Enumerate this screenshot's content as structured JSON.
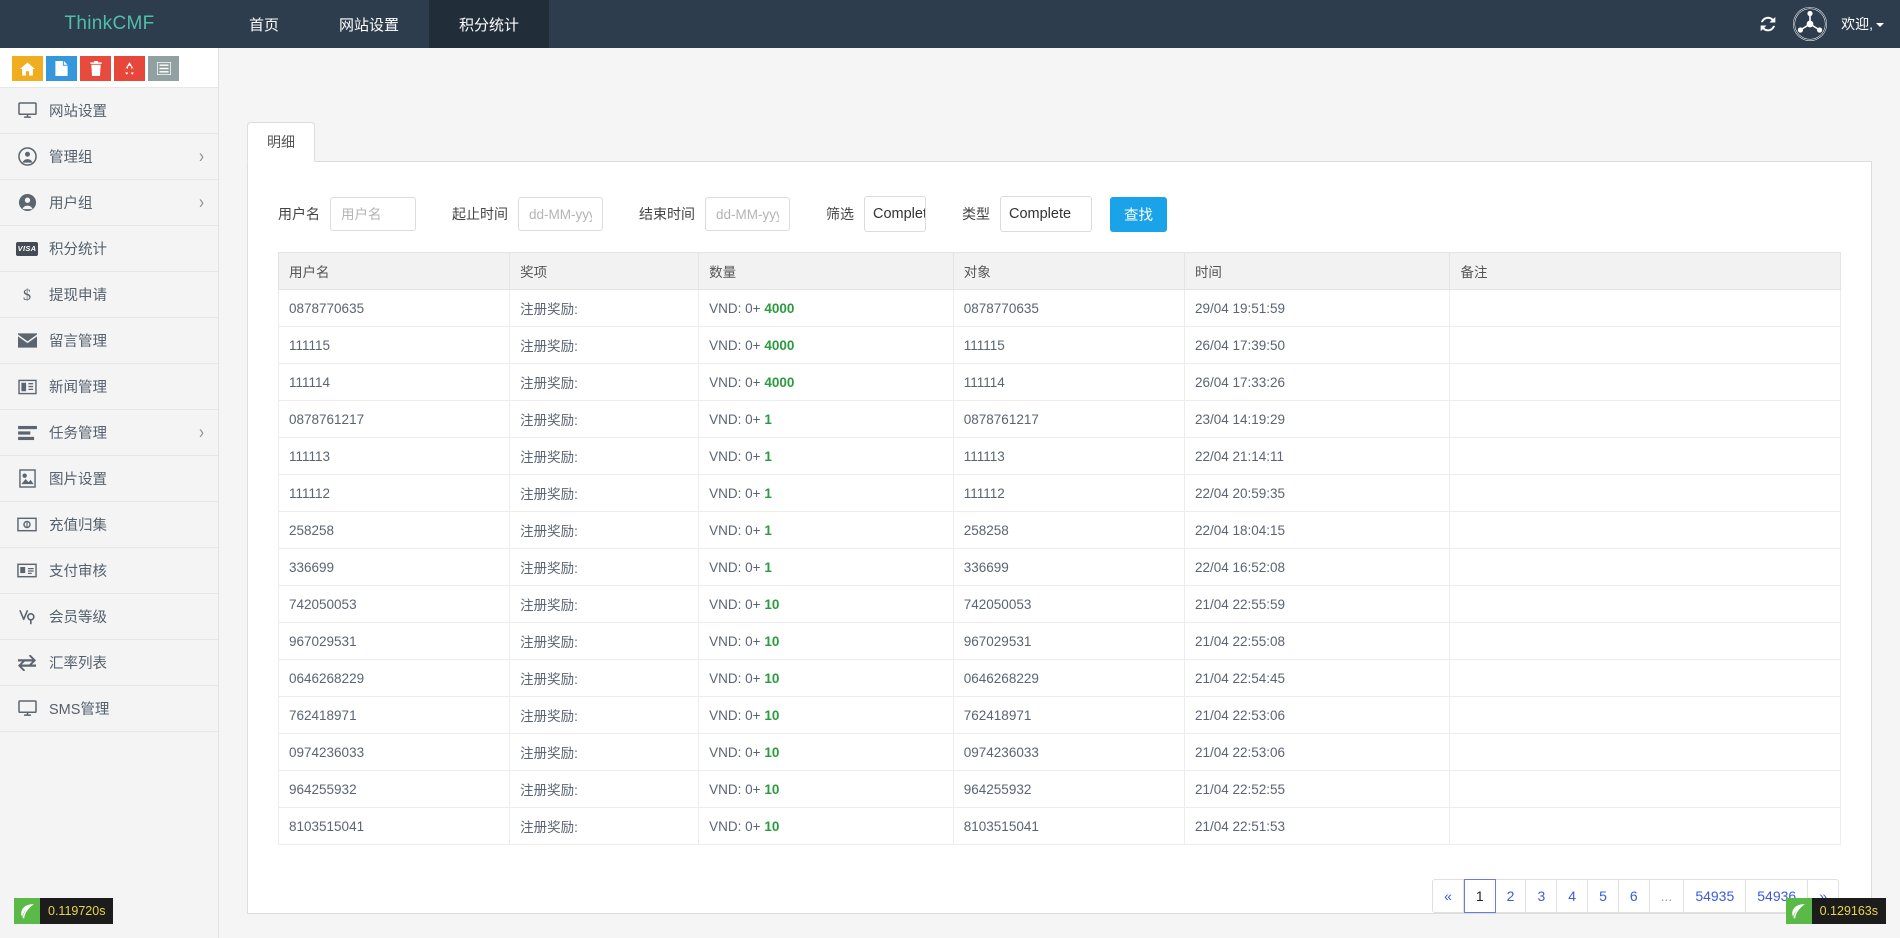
{
  "topnav": {
    "brand": "ThinkCMF",
    "items": [
      {
        "label": "首页",
        "active": false
      },
      {
        "label": "网站设置",
        "active": false
      },
      {
        "label": "积分统计",
        "active": true
      }
    ],
    "refresh_icon": "refresh-icon",
    "avatar_icon": "user-avatar-icon",
    "welcome": "欢迎,"
  },
  "sidebar": {
    "quick_buttons": [
      {
        "name": "home-quick-button",
        "icon": "home-icon",
        "color": "#f0ad20"
      },
      {
        "name": "new-page-quick-button",
        "icon": "file-icon",
        "color": "#3598dc"
      },
      {
        "name": "trash-quick-button",
        "icon": "trash-icon",
        "color": "#e74b3e"
      },
      {
        "name": "recycle-quick-button",
        "icon": "recycle-icon",
        "color": "#e7463a"
      },
      {
        "name": "list-quick-button",
        "icon": "list-icon",
        "color": "#91a0a0"
      }
    ],
    "items": [
      {
        "label": "网站设置",
        "icon": "monitor-icon",
        "arrow": false
      },
      {
        "label": "管理组",
        "icon": "user-circle-icon",
        "arrow": true
      },
      {
        "label": "用户组",
        "icon": "user-filled-icon",
        "arrow": true
      },
      {
        "label": "积分统计",
        "icon": "visa-card-icon",
        "arrow": false
      },
      {
        "label": "提现申请",
        "icon": "dollar-icon",
        "arrow": false
      },
      {
        "label": "留言管理",
        "icon": "envelope-icon",
        "arrow": false
      },
      {
        "label": "新闻管理",
        "icon": "newspaper-icon",
        "arrow": false
      },
      {
        "label": "任务管理",
        "icon": "tasks-icon",
        "arrow": true
      },
      {
        "label": "图片设置",
        "icon": "image-icon",
        "arrow": false
      },
      {
        "label": "充值归集",
        "icon": "money-bill-icon",
        "arrow": false
      },
      {
        "label": "支付审核",
        "icon": "id-card-icon",
        "arrow": false
      },
      {
        "label": "会员等级",
        "icon": "vip-icon",
        "arrow": false
      },
      {
        "label": "汇率列表",
        "icon": "exchange-arrows-icon",
        "arrow": false
      },
      {
        "label": "SMS管理",
        "icon": "monitor-icon",
        "arrow": false
      }
    ]
  },
  "main": {
    "tabs": [
      {
        "label": "明细",
        "active": true
      }
    ],
    "filter": {
      "username_label": "用户名",
      "username_placeholder": "用户名",
      "username_value": "",
      "start_label": "起止时间",
      "start_placeholder": "dd-MM-yyyy",
      "start_value": "",
      "end_label": "结束时间",
      "end_placeholder": "dd-MM-yyyy",
      "end_value": "",
      "filter_label": "筛选",
      "filter_value": "Complete",
      "type_label": "类型",
      "type_value": "Complete",
      "search_button": "查找"
    },
    "table": {
      "headers": [
        "用户名",
        "奖项",
        "数量",
        "对象",
        "时间",
        "备注"
      ],
      "rows": [
        {
          "user": "0878770635",
          "prize": "注册奖励:",
          "amount_prefix": "VND: 0+",
          "amount": "4000",
          "target": "0878770635",
          "time": "29/04 19:51:59",
          "note": ""
        },
        {
          "user": "111115",
          "prize": "注册奖励:",
          "amount_prefix": "VND: 0+",
          "amount": "4000",
          "target": "111115",
          "time": "26/04 17:39:50",
          "note": ""
        },
        {
          "user": "111114",
          "prize": "注册奖励:",
          "amount_prefix": "VND: 0+",
          "amount": "4000",
          "target": "111114",
          "time": "26/04 17:33:26",
          "note": ""
        },
        {
          "user": "0878761217",
          "prize": "注册奖励:",
          "amount_prefix": "VND: 0+",
          "amount": "1",
          "target": "0878761217",
          "time": "23/04 14:19:29",
          "note": ""
        },
        {
          "user": "111113",
          "prize": "注册奖励:",
          "amount_prefix": "VND: 0+",
          "amount": "1",
          "target": "111113",
          "time": "22/04 21:14:11",
          "note": ""
        },
        {
          "user": "111112",
          "prize": "注册奖励:",
          "amount_prefix": "VND: 0+",
          "amount": "1",
          "target": "111112",
          "time": "22/04 20:59:35",
          "note": ""
        },
        {
          "user": "258258",
          "prize": "注册奖励:",
          "amount_prefix": "VND: 0+",
          "amount": "1",
          "target": "258258",
          "time": "22/04 18:04:15",
          "note": ""
        },
        {
          "user": "336699",
          "prize": "注册奖励:",
          "amount_prefix": "VND: 0+",
          "amount": "1",
          "target": "336699",
          "time": "22/04 16:52:08",
          "note": ""
        },
        {
          "user": "742050053",
          "prize": "注册奖励:",
          "amount_prefix": "VND: 0+",
          "amount": "10",
          "target": "742050053",
          "time": "21/04 22:55:59",
          "note": ""
        },
        {
          "user": "967029531",
          "prize": "注册奖励:",
          "amount_prefix": "VND: 0+",
          "amount": "10",
          "target": "967029531",
          "time": "21/04 22:55:08",
          "note": ""
        },
        {
          "user": "0646268229",
          "prize": "注册奖励:",
          "amount_prefix": "VND: 0+",
          "amount": "10",
          "target": "0646268229",
          "time": "21/04 22:54:45",
          "note": ""
        },
        {
          "user": "762418971",
          "prize": "注册奖励:",
          "amount_prefix": "VND: 0+",
          "amount": "10",
          "target": "762418971",
          "time": "21/04 22:53:06",
          "note": ""
        },
        {
          "user": "0974236033",
          "prize": "注册奖励:",
          "amount_prefix": "VND: 0+",
          "amount": "10",
          "target": "0974236033",
          "time": "21/04 22:53:06",
          "note": ""
        },
        {
          "user": "964255932",
          "prize": "注册奖励:",
          "amount_prefix": "VND: 0+",
          "amount": "10",
          "target": "964255932",
          "time": "21/04 22:52:55",
          "note": ""
        },
        {
          "user": "8103515041",
          "prize": "注册奖励:",
          "amount_prefix": "VND: 0+",
          "amount": "10",
          "target": "8103515041",
          "time": "21/04 22:51:53",
          "note": ""
        }
      ]
    },
    "pagination": [
      {
        "label": "«",
        "active": false,
        "ellipsis": false
      },
      {
        "label": "1",
        "active": true,
        "ellipsis": false
      },
      {
        "label": "2",
        "active": false,
        "ellipsis": false
      },
      {
        "label": "3",
        "active": false,
        "ellipsis": false
      },
      {
        "label": "4",
        "active": false,
        "ellipsis": false
      },
      {
        "label": "5",
        "active": false,
        "ellipsis": false
      },
      {
        "label": "6",
        "active": false,
        "ellipsis": false
      },
      {
        "label": "...",
        "active": false,
        "ellipsis": true
      },
      {
        "label": "54935",
        "active": false,
        "ellipsis": false
      },
      {
        "label": "54936",
        "active": false,
        "ellipsis": false
      },
      {
        "label": "»",
        "active": false,
        "ellipsis": false
      }
    ]
  },
  "debug": {
    "left_time": "0.119720s",
    "right_time": "0.129163s"
  },
  "colors": {
    "brand": "#4fbfa8",
    "nav_bg": "#2e3d4e",
    "nav_active": "#222d3a",
    "accent_blue": "#1aa3e8",
    "amount_green": "#2a9b3f",
    "pager_link": "#3b5bdb"
  }
}
